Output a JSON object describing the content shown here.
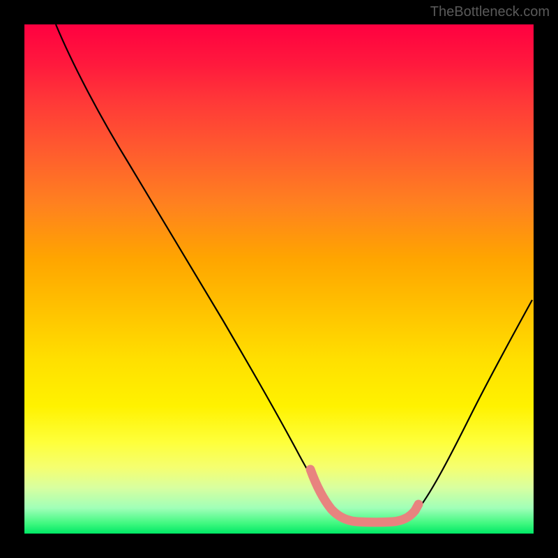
{
  "watermark": "TheBottleneck.com",
  "chart_data": {
    "type": "line",
    "title": "",
    "xlabel": "",
    "ylabel": "",
    "xlim": [
      0,
      100
    ],
    "ylim": [
      0,
      100
    ],
    "series": [
      {
        "name": "main-curve",
        "x": [
          6,
          12,
          20,
          28,
          36,
          44,
          50,
          55,
          58,
          60,
          63,
          66,
          70,
          73,
          76,
          80,
          86,
          92,
          98,
          100
        ],
        "y": [
          100,
          90,
          77,
          64,
          51,
          38,
          28,
          18,
          12,
          8,
          5,
          4,
          4,
          4,
          5,
          8,
          17,
          28,
          40,
          45
        ]
      },
      {
        "name": "pink-overlay",
        "x": [
          56,
          58,
          60,
          62,
          64,
          66,
          68,
          70,
          72,
          74,
          76,
          77
        ],
        "y": [
          13,
          9,
          7,
          5.5,
          4.5,
          4,
          4,
          4,
          4,
          4.5,
          5.5,
          7
        ]
      }
    ],
    "legend_position": "none",
    "grid": false,
    "background_gradient": [
      "#ff0040",
      "#ffe000",
      "#00e865"
    ]
  }
}
